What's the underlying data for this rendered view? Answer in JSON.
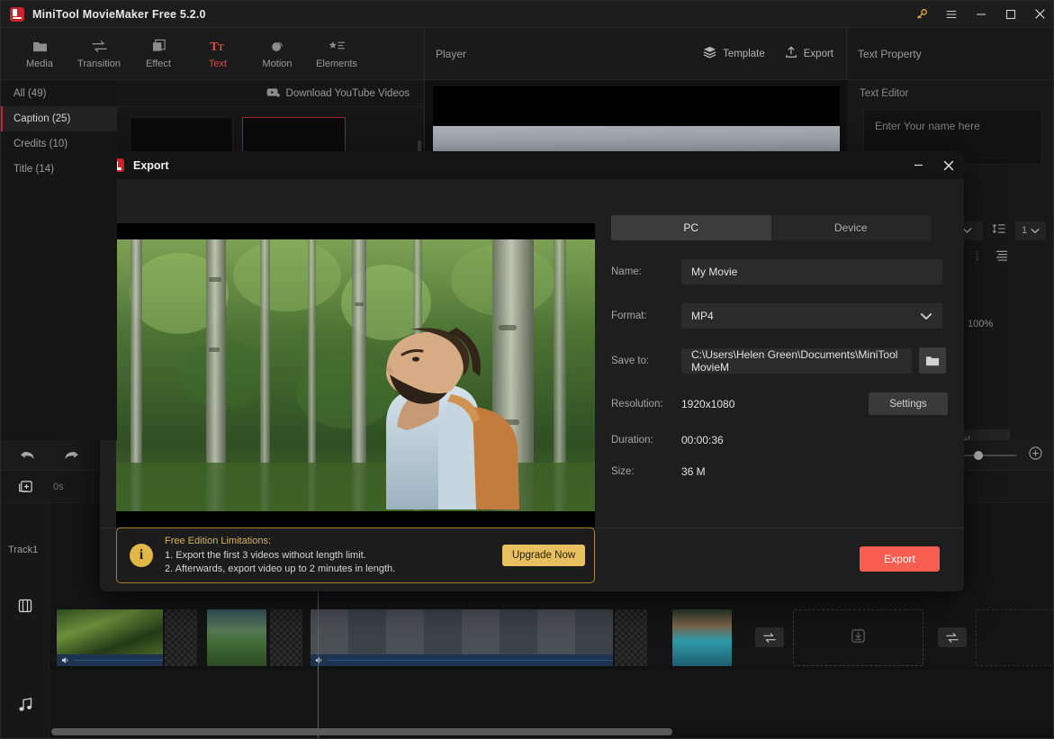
{
  "window": {
    "title": "MiniTool MovieMaker Free 5.2.0",
    "controls": [
      {
        "name": "key-icon",
        "label": "⚿"
      },
      {
        "name": "menu-icon",
        "label": "≡"
      },
      {
        "name": "minimize-icon",
        "label": "−"
      },
      {
        "name": "maximize-icon",
        "label": "□"
      },
      {
        "name": "close-icon",
        "label": "✕"
      }
    ],
    "accent": "#c9232d"
  },
  "toolbar": {
    "items": [
      {
        "label": "Media",
        "icon": "folder-icon",
        "active": false
      },
      {
        "label": "Transition",
        "icon": "transition-icon",
        "active": false
      },
      {
        "label": "Effect",
        "icon": "effect-icon",
        "active": false
      },
      {
        "label": "Text",
        "icon": "text-icon",
        "active": true
      },
      {
        "label": "Motion",
        "icon": "motion-icon",
        "active": false
      },
      {
        "label": "Elements",
        "icon": "elements-icon",
        "active": false
      }
    ],
    "active_color": "#e04b45"
  },
  "library": {
    "download_link": "Download YouTube Videos",
    "categories": [
      {
        "label": "All (49)",
        "selected": false
      },
      {
        "label": "Caption (25)",
        "selected": true
      },
      {
        "label": "Credits (10)",
        "selected": false
      },
      {
        "label": "Title (14)",
        "selected": false
      }
    ],
    "template_text": "Enter your name here"
  },
  "player": {
    "title": "Player",
    "template_button": "Template",
    "export_button": "Export"
  },
  "text_property": {
    "title": "Text Property",
    "editor_label": "Text Editor",
    "editor_value": "Enter Your name here",
    "line_count": "1",
    "opacity": "100%",
    "reset_label": "Reset"
  },
  "timeline": {
    "time_marker": "0s",
    "track_label": "Track1",
    "icons": {
      "undo": "undo-icon",
      "redo": "redo-icon",
      "add_media": "add-media-icon",
      "video_track": "video-track-icon",
      "audio_track": "audio-track-icon"
    }
  },
  "export_dialog": {
    "title": "Export",
    "minimize_icon": "−",
    "close_icon": "✕",
    "tabs": [
      {
        "label": "PC",
        "active": true
      },
      {
        "label": "Device",
        "active": false
      }
    ],
    "fields": {
      "name_label": "Name:",
      "name_value": "My Movie",
      "format_label": "Format:",
      "format_value": "MP4",
      "saveto_label": "Save to:",
      "saveto_value": "C:\\Users\\Helen Green\\Documents\\MiniTool MovieM",
      "resolution_label": "Resolution:",
      "resolution_value": "1920x1080",
      "settings_button": "Settings",
      "duration_label": "Duration:",
      "duration_value": "00:00:36",
      "size_label": "Size:",
      "size_value": "36 M"
    },
    "notice": {
      "title": "Free Edition Limitations:",
      "line1": "1. Export the first 3 videos without length limit.",
      "line2": "2. Afterwards, export video up to 2 minutes in length.",
      "upgrade_button": "Upgrade Now",
      "border_color": "#a6832f",
      "icon_color": "#e1b74a"
    },
    "export_button": "Export",
    "export_button_color": "#f85e4f"
  }
}
